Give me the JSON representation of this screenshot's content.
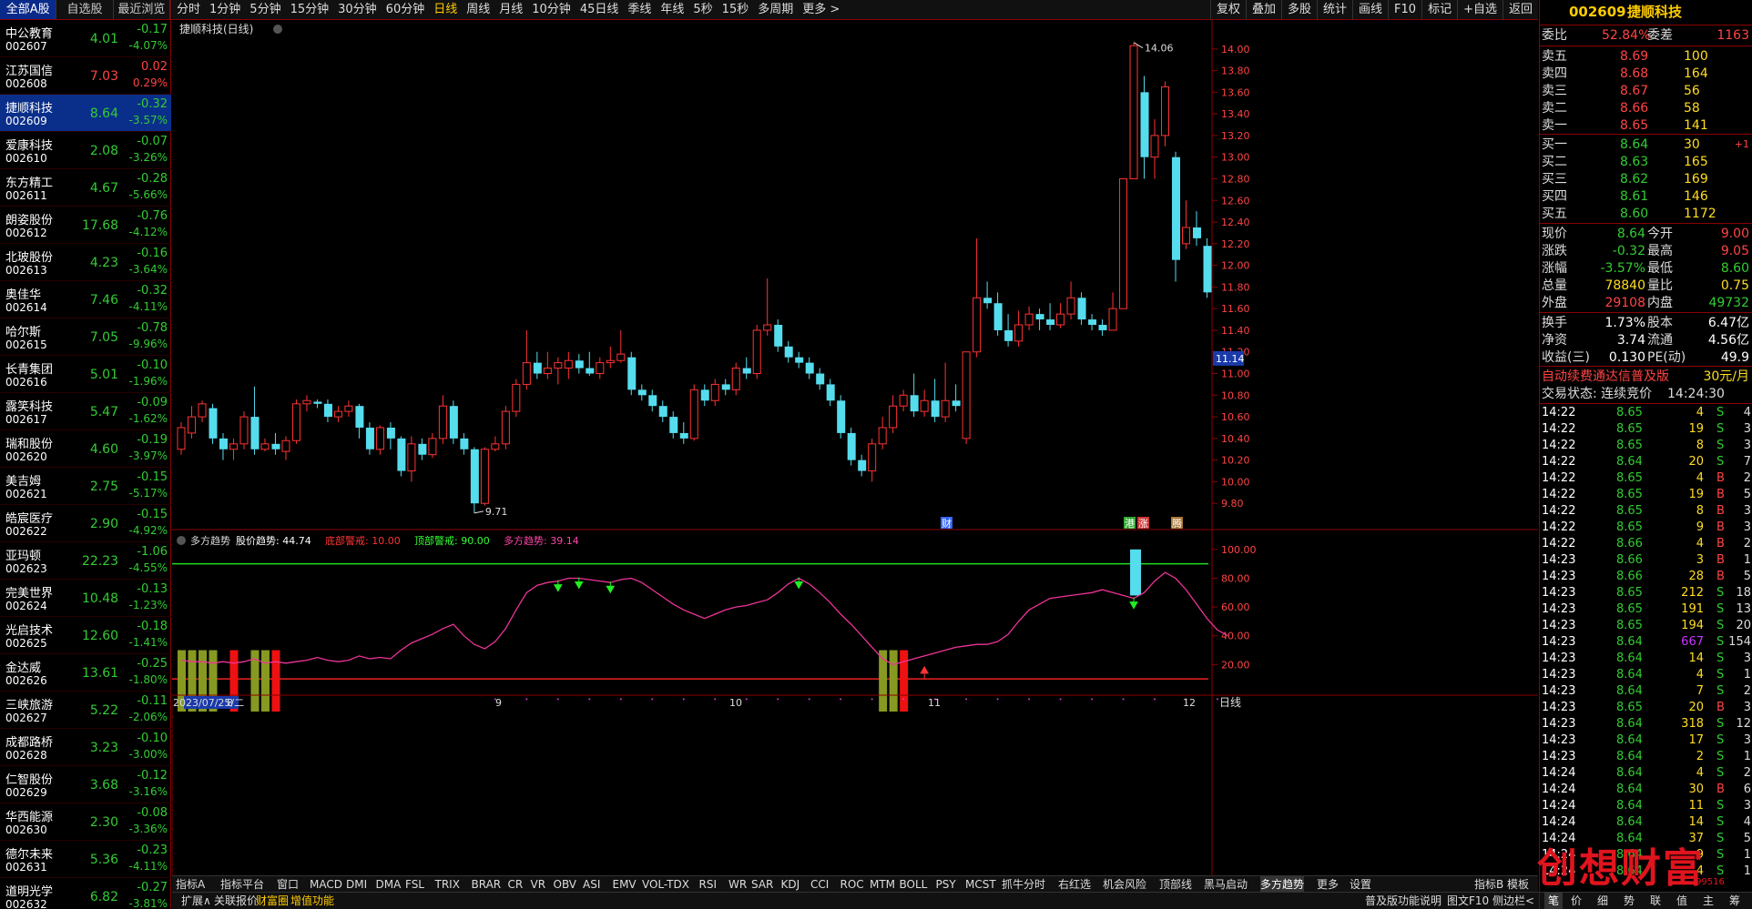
{
  "left_tabs": [
    "全部A股",
    "自选股",
    "最近浏览"
  ],
  "stocks": [
    {
      "name": "中公教育",
      "code": "002607",
      "price": "4.01",
      "change": "-0.17",
      "pct": "-4.07%",
      "dir": "dn"
    },
    {
      "name": "江苏国信",
      "code": "002608",
      "price": "7.03",
      "change": "0.02",
      "pct": "0.29%",
      "dir": "up"
    },
    {
      "name": "捷顺科技",
      "code": "002609",
      "price": "8.64",
      "change": "-0.32",
      "pct": "-3.57%",
      "dir": "dn",
      "selected": true
    },
    {
      "name": "爱康科技",
      "code": "002610",
      "price": "2.08",
      "change": "-0.07",
      "pct": "-3.26%",
      "dir": "dn"
    },
    {
      "name": "东方精工",
      "code": "002611",
      "price": "4.67",
      "change": "-0.28",
      "pct": "-5.66%",
      "dir": "dn"
    },
    {
      "name": "朗姿股份",
      "code": "002612",
      "price": "17.68",
      "change": "-0.76",
      "pct": "-4.12%",
      "dir": "dn"
    },
    {
      "name": "北玻股份",
      "code": "002613",
      "price": "4.23",
      "change": "-0.16",
      "pct": "-3.64%",
      "dir": "dn"
    },
    {
      "name": "奥佳华",
      "code": "002614",
      "price": "7.46",
      "change": "-0.32",
      "pct": "-4.11%",
      "dir": "dn"
    },
    {
      "name": "哈尔斯",
      "code": "002615",
      "price": "7.05",
      "change": "-0.78",
      "pct": "-9.96%",
      "dir": "dn"
    },
    {
      "name": "长青集团",
      "code": "002616",
      "price": "5.01",
      "change": "-0.10",
      "pct": "-1.96%",
      "dir": "dn"
    },
    {
      "name": "露笑科技",
      "code": "002617",
      "price": "5.47",
      "change": "-0.09",
      "pct": "-1.62%",
      "dir": "dn"
    },
    {
      "name": "瑞和股份",
      "code": "002620",
      "price": "4.60",
      "change": "-0.19",
      "pct": "-3.97%",
      "dir": "dn"
    },
    {
      "name": "美吉姆",
      "code": "002621",
      "price": "2.75",
      "change": "-0.15",
      "pct": "-5.17%",
      "dir": "dn"
    },
    {
      "name": "皓宸医疗",
      "code": "002622",
      "price": "2.90",
      "change": "-0.15",
      "pct": "-4.92%",
      "dir": "dn"
    },
    {
      "name": "亚玛顿",
      "code": "002623",
      "price": "22.23",
      "change": "-1.06",
      "pct": "-4.55%",
      "dir": "dn"
    },
    {
      "name": "完美世界",
      "code": "002624",
      "price": "10.48",
      "change": "-0.13",
      "pct": "-1.23%",
      "dir": "dn"
    },
    {
      "name": "光启技术",
      "code": "002625",
      "price": "12.60",
      "change": "-0.18",
      "pct": "-1.41%",
      "dir": "dn"
    },
    {
      "name": "金达威",
      "code": "002626",
      "price": "13.61",
      "change": "-0.25",
      "pct": "-1.80%",
      "dir": "dn"
    },
    {
      "name": "三峡旅游",
      "code": "002627",
      "price": "5.22",
      "change": "-0.11",
      "pct": "-2.06%",
      "dir": "dn"
    },
    {
      "name": "成都路桥",
      "code": "002628",
      "price": "3.23",
      "change": "-0.10",
      "pct": "-3.00%",
      "dir": "dn"
    },
    {
      "name": "仁智股份",
      "code": "002629",
      "price": "3.68",
      "change": "-0.12",
      "pct": "-3.16%",
      "dir": "dn"
    },
    {
      "name": "华西能源",
      "code": "002630",
      "price": "2.30",
      "change": "-0.08",
      "pct": "-3.36%",
      "dir": "dn"
    },
    {
      "name": "德尔未来",
      "code": "002631",
      "price": "5.36",
      "change": "-0.23",
      "pct": "-4.11%",
      "dir": "dn"
    },
    {
      "name": "道明光学",
      "code": "002632",
      "price": "6.82",
      "change": "-0.27",
      "pct": "-3.81%",
      "dir": "dn"
    }
  ],
  "toolbar": {
    "items": [
      "分时",
      "1分钟",
      "5分钟",
      "15分钟",
      "30分钟",
      "60分钟",
      "日线",
      "周线",
      "月线",
      "10分钟",
      "45日线",
      "季线",
      "年线",
      "5秒",
      "15秒",
      "多周期",
      "更多 >"
    ],
    "active": "日线",
    "right": [
      "复权",
      "叠加",
      "多股",
      "统计",
      "画线",
      "F10",
      "标记",
      "+自选",
      "返回"
    ]
  },
  "chart": {
    "title": "捷顺科技(日线)",
    "high_label": "14.06",
    "low_label": "9.71",
    "current_price_tag": "11.14",
    "price_axis": [
      "14.00",
      "13.80",
      "13.60",
      "13.40",
      "13.20",
      "13.00",
      "12.80",
      "12.60",
      "12.40",
      "12.20",
      "12.00",
      "11.80",
      "11.60",
      "11.40",
      "11.20",
      "11.00",
      "10.80",
      "10.60",
      "10.40",
      "10.20",
      "10.00",
      "9.80"
    ],
    "event_marks": [
      "财",
      "港",
      "涨",
      "腾"
    ],
    "indicator_title": "多方趋势",
    "indicator_values": [
      {
        "label": "股价趋势: 44.74",
        "color": "#ffffff"
      },
      {
        "label": "底部警戒: 10.00",
        "color": "#ff3333"
      },
      {
        "label": "顶部警戒: 90.00",
        "color": "#33ff33"
      },
      {
        "label": "多方趋势: 39.14",
        "color": "#ff44aa"
      }
    ],
    "indicator_axis": [
      "100.00",
      "80.00",
      "60.00",
      "40.00",
      "20.00"
    ],
    "date_labels": [
      "2023/07/25/二",
      "8",
      "9",
      "10",
      "11",
      "12"
    ],
    "period_label": "日线"
  },
  "chart_data": {
    "type": "candlestick",
    "ylim": [
      9.6,
      14.2
    ],
    "candles": [
      [
        10.3,
        10.5,
        10.25,
        10.55
      ],
      [
        10.45,
        10.6,
        10.4,
        10.7
      ],
      [
        10.6,
        10.72,
        10.55,
        10.75
      ],
      [
        10.68,
        10.4,
        10.35,
        10.72
      ],
      [
        10.4,
        10.3,
        10.2,
        10.45
      ],
      [
        10.3,
        10.35,
        10.2,
        10.4
      ],
      [
        10.35,
        10.6,
        10.3,
        10.65
      ],
      [
        10.6,
        10.3,
        10.25,
        10.88
      ],
      [
        10.3,
        10.35,
        10.28,
        10.4
      ],
      [
        10.35,
        10.3,
        10.25,
        10.45
      ],
      [
        10.28,
        10.38,
        10.2,
        10.42
      ],
      [
        10.38,
        10.72,
        10.35,
        10.76
      ],
      [
        10.72,
        10.75,
        10.65,
        10.8
      ],
      [
        10.74,
        10.72,
        10.68,
        10.76
      ],
      [
        10.72,
        10.6,
        10.55,
        10.76
      ],
      [
        10.6,
        10.65,
        10.55,
        10.7
      ],
      [
        10.65,
        10.7,
        10.6,
        10.75
      ],
      [
        10.7,
        10.5,
        10.4,
        10.72
      ],
      [
        10.5,
        10.3,
        10.25,
        10.55
      ],
      [
        10.3,
        10.5,
        10.25,
        10.52
      ],
      [
        10.5,
        10.4,
        10.3,
        10.55
      ],
      [
        10.4,
        10.1,
        10.05,
        10.42
      ],
      [
        10.1,
        10.35,
        10.0,
        10.42
      ],
      [
        10.35,
        10.25,
        10.2,
        10.4
      ],
      [
        10.25,
        10.4,
        10.22,
        10.45
      ],
      [
        10.4,
        10.7,
        10.35,
        10.8
      ],
      [
        10.7,
        10.4,
        10.35,
        10.75
      ],
      [
        10.4,
        10.3,
        10.25,
        10.45
      ],
      [
        10.3,
        9.8,
        9.71,
        10.32
      ],
      [
        9.8,
        10.3,
        9.78,
        10.32
      ],
      [
        10.3,
        10.35,
        10.28,
        10.42
      ],
      [
        10.35,
        10.65,
        10.3,
        10.7
      ],
      [
        10.65,
        10.9,
        10.6,
        10.95
      ],
      [
        10.9,
        11.1,
        10.85,
        11.4
      ],
      [
        11.1,
        11.0,
        10.95,
        11.2
      ],
      [
        11.0,
        11.05,
        10.95,
        11.2
      ],
      [
        11.05,
        11.1,
        10.9,
        11.15
      ],
      [
        11.05,
        11.12,
        10.95,
        11.2
      ],
      [
        11.12,
        11.05,
        11.0,
        11.18
      ],
      [
        11.05,
        11.0,
        10.98,
        11.2
      ],
      [
        11.0,
        11.1,
        10.95,
        11.15
      ],
      [
        11.1,
        11.12,
        11.05,
        11.25
      ],
      [
        11.12,
        11.18,
        11.1,
        11.4
      ],
      [
        11.15,
        10.85,
        10.8,
        11.2
      ],
      [
        10.85,
        10.8,
        10.75,
        10.9
      ],
      [
        10.8,
        10.7,
        10.65,
        10.85
      ],
      [
        10.7,
        10.6,
        10.55,
        10.75
      ],
      [
        10.6,
        10.45,
        10.4,
        10.65
      ],
      [
        10.45,
        10.4,
        10.35,
        10.55
      ],
      [
        10.4,
        10.85,
        10.38,
        10.9
      ],
      [
        10.85,
        10.75,
        10.7,
        10.9
      ],
      [
        10.75,
        10.9,
        10.7,
        10.95
      ],
      [
        10.9,
        10.85,
        10.8,
        10.95
      ],
      [
        10.85,
        11.05,
        10.8,
        11.1
      ],
      [
        11.05,
        11.0,
        10.95,
        11.15
      ],
      [
        11.0,
        11.4,
        10.95,
        11.45
      ],
      [
        11.4,
        11.45,
        11.35,
        11.88
      ],
      [
        11.45,
        11.25,
        11.2,
        11.5
      ],
      [
        11.25,
        11.15,
        11.1,
        11.3
      ],
      [
        11.15,
        11.1,
        11.05,
        11.2
      ],
      [
        11.1,
        11.0,
        10.95,
        11.15
      ],
      [
        11.0,
        10.9,
        10.85,
        11.05
      ],
      [
        10.9,
        10.75,
        10.7,
        10.95
      ],
      [
        10.75,
        10.45,
        10.4,
        10.8
      ],
      [
        10.45,
        10.2,
        10.15,
        10.5
      ],
      [
        10.2,
        10.1,
        10.05,
        10.25
      ],
      [
        10.1,
        10.35,
        10.0,
        10.4
      ],
      [
        10.35,
        10.5,
        10.3,
        10.6
      ],
      [
        10.5,
        10.7,
        10.45,
        10.8
      ],
      [
        10.7,
        10.8,
        10.65,
        10.85
      ],
      [
        10.8,
        10.65,
        10.6,
        11.0
      ],
      [
        10.65,
        10.75,
        10.6,
        10.85
      ],
      [
        10.75,
        10.6,
        10.55,
        10.95
      ],
      [
        10.6,
        10.75,
        10.55,
        11.1
      ],
      [
        10.75,
        10.7,
        10.65,
        10.9
      ],
      [
        10.4,
        11.2,
        10.35,
        11.2
      ],
      [
        11.2,
        11.7,
        11.15,
        12.25
      ],
      [
        11.7,
        11.65,
        11.6,
        11.85
      ],
      [
        11.65,
        11.4,
        11.35,
        11.75
      ],
      [
        11.4,
        11.3,
        11.25,
        11.55
      ],
      [
        11.3,
        11.45,
        11.25,
        11.58
      ],
      [
        11.45,
        11.55,
        11.4,
        11.62
      ],
      [
        11.55,
        11.5,
        11.4,
        11.6
      ],
      [
        11.5,
        11.45,
        11.4,
        11.65
      ],
      [
        11.45,
        11.55,
        11.42,
        11.65
      ],
      [
        11.55,
        11.7,
        11.5,
        11.85
      ],
      [
        11.7,
        11.5,
        11.45,
        11.75
      ],
      [
        11.5,
        11.45,
        11.4,
        11.55
      ],
      [
        11.45,
        11.4,
        11.35,
        11.5
      ],
      [
        11.4,
        11.6,
        11.45,
        11.75
      ],
      [
        11.6,
        12.8,
        11.6,
        12.8
      ],
      [
        12.8,
        14.03,
        12.8,
        14.06
      ],
      [
        13.6,
        13.0,
        12.8,
        13.75
      ],
      [
        13.0,
        13.2,
        12.8,
        13.35
      ],
      [
        13.2,
        13.65,
        13.1,
        13.7
      ],
      [
        13.0,
        12.05,
        11.85,
        13.05
      ],
      [
        12.2,
        12.35,
        12.15,
        12.6
      ],
      [
        12.35,
        12.25,
        12.18,
        12.5
      ],
      [
        12.18,
        11.75,
        11.7,
        12.25
      ]
    ],
    "indicator": {
      "trend": [
        23,
        22,
        22,
        21,
        22,
        21,
        22,
        24,
        21,
        22,
        21,
        22,
        23,
        25,
        23,
        22,
        23,
        26,
        24,
        25,
        24,
        30,
        35,
        38,
        41,
        45,
        48,
        40,
        34,
        31,
        36,
        45,
        58,
        70,
        75,
        77,
        78,
        80,
        80,
        79,
        78,
        77,
        79,
        80,
        77,
        72,
        67,
        62,
        58,
        55,
        52,
        55,
        58,
        60,
        61,
        63,
        65,
        70,
        76,
        80,
        76,
        70,
        63,
        55,
        48,
        40,
        32,
        24,
        20,
        22,
        24,
        26,
        28,
        30,
        32,
        33,
        34,
        34,
        36,
        41,
        50,
        58,
        62,
        66,
        67,
        68,
        69,
        70,
        72,
        70,
        68,
        66,
        70,
        78,
        84,
        80,
        72,
        62,
        52,
        44,
        40
      ],
      "top_line": 90,
      "bottom_line": 10,
      "ylim": [
        0,
        110
      ]
    }
  },
  "right_panel": {
    "code": "002609",
    "name": "捷顺科技",
    "weibi": {
      "label": "委比",
      "value": "52.84%",
      "diff_label": "委差",
      "diff": "1163"
    },
    "asks": [
      {
        "label": "卖五",
        "price": "8.69",
        "vol": "100"
      },
      {
        "label": "卖四",
        "price": "8.68",
        "vol": "164"
      },
      {
        "label": "卖三",
        "price": "8.67",
        "vol": "56"
      },
      {
        "label": "卖二",
        "price": "8.66",
        "vol": "58"
      },
      {
        "label": "卖一",
        "price": "8.65",
        "vol": "141"
      }
    ],
    "bids": [
      {
        "label": "买一",
        "price": "8.64",
        "vol": "30",
        "extra": "+1"
      },
      {
        "label": "买二",
        "price": "8.63",
        "vol": "165",
        "extra": ""
      },
      {
        "label": "买三",
        "price": "8.62",
        "vol": "169",
        "extra": ""
      },
      {
        "label": "买四",
        "price": "8.61",
        "vol": "146",
        "extra": ""
      },
      {
        "label": "买五",
        "price": "8.60",
        "vol": "1172",
        "extra": ""
      }
    ],
    "quote": [
      {
        "l1": "现价",
        "v1": "8.64",
        "c1": "dn",
        "l2": "今开",
        "v2": "9.00",
        "c2": "up"
      },
      {
        "l1": "涨跌",
        "v1": "-0.32",
        "c1": "dn",
        "l2": "最高",
        "v2": "9.05",
        "c2": "up"
      },
      {
        "l1": "涨幅",
        "v1": "-3.57%",
        "c1": "dn",
        "l2": "最低",
        "v2": "8.60",
        "c2": "dn"
      },
      {
        "l1": "总量",
        "v1": "78840",
        "c1": "yl",
        "l2": "量比",
        "v2": "0.75",
        "c2": "yl"
      },
      {
        "l1": "外盘",
        "v1": "29108",
        "c1": "up",
        "l2": "内盘",
        "v2": "49732",
        "c2": "dn"
      }
    ],
    "fin": [
      {
        "l1": "换手",
        "v1": "1.73%",
        "l2": "股本",
        "v2": "6.47亿"
      },
      {
        "l1": "净资",
        "v1": "3.74",
        "l2": "流通",
        "v2": "4.56亿"
      },
      {
        "l1": "收益(三)",
        "v1": "0.130",
        "l2": "PE(动)",
        "v2": "49.9"
      }
    ],
    "promo": {
      "text": "自动续费通达信普及版",
      "price": "30元/月"
    },
    "trade_status": {
      "label": "交易状态: 连续竞价",
      "time": "14:24:30"
    },
    "ticks": [
      [
        "14:22",
        "8.65",
        "4",
        "S",
        "4"
      ],
      [
        "14:22",
        "8.65",
        "19",
        "S",
        "3"
      ],
      [
        "14:22",
        "8.65",
        "8",
        "S",
        "3"
      ],
      [
        "14:22",
        "8.64",
        "20",
        "S",
        "7"
      ],
      [
        "14:22",
        "8.65",
        "4",
        "B",
        "2"
      ],
      [
        "14:22",
        "8.65",
        "19",
        "B",
        "5"
      ],
      [
        "14:22",
        "8.65",
        "8",
        "B",
        "3"
      ],
      [
        "14:22",
        "8.65",
        "9",
        "B",
        "3"
      ],
      [
        "14:22",
        "8.66",
        "4",
        "B",
        "2"
      ],
      [
        "14:23",
        "8.66",
        "3",
        "B",
        "1"
      ],
      [
        "14:23",
        "8.66",
        "28",
        "B",
        "5"
      ],
      [
        "14:23",
        "8.65",
        "212",
        "S",
        "18"
      ],
      [
        "14:23",
        "8.65",
        "191",
        "S",
        "13"
      ],
      [
        "14:23",
        "8.65",
        "194",
        "S",
        "20"
      ],
      [
        "14:23",
        "8.64",
        "667",
        "S",
        "154"
      ],
      [
        "14:23",
        "8.64",
        "14",
        "S",
        "3"
      ],
      [
        "14:23",
        "8.64",
        "4",
        "S",
        "1"
      ],
      [
        "14:23",
        "8.64",
        "7",
        "S",
        "2"
      ],
      [
        "14:23",
        "8.65",
        "20",
        "B",
        "3"
      ],
      [
        "14:23",
        "8.64",
        "318",
        "S",
        "12"
      ],
      [
        "14:23",
        "8.64",
        "17",
        "S",
        "3"
      ],
      [
        "14:23",
        "8.64",
        "2",
        "S",
        "1"
      ],
      [
        "14:24",
        "8.64",
        "4",
        "S",
        "2"
      ],
      [
        "14:24",
        "8.64",
        "30",
        "B",
        "6"
      ],
      [
        "14:24",
        "8.64",
        "11",
        "S",
        "3"
      ],
      [
        "14:24",
        "8.64",
        "14",
        "S",
        "4"
      ],
      [
        "14:24",
        "8.64",
        "37",
        "S",
        "5"
      ],
      [
        "14:24",
        "8.64",
        "9",
        "S",
        "1"
      ],
      [
        "14:24",
        "8.64",
        "4",
        "S",
        "1"
      ]
    ]
  },
  "bottom_tabs": [
    "指标A",
    "指标平台",
    "窗口",
    "MACD",
    "DMI",
    "DMA",
    "FSL",
    "TRIX",
    "BRAR",
    "CR",
    "VR",
    "OBV",
    "ASI",
    "EMV",
    "VOL-TDX",
    "RSI",
    "WR",
    "SAR",
    "KDJ",
    "CCI",
    "ROC",
    "MTM",
    "BOLL",
    "PSY",
    "MCST",
    "抓牛分时",
    "右红选",
    "机会风险",
    "顶部线",
    "黑马启动",
    "多方趋势",
    "更多",
    "设置"
  ],
  "bottom_tab_active": "多方趋势",
  "bottom_tab_right": [
    "指标B",
    "模板"
  ],
  "bottom2_left": [
    "扩展∧",
    "关联报价",
    "财富圈",
    "增值功能"
  ],
  "bottom2_right": [
    "普及版功能说明",
    "图文F10",
    "侧边栏<"
  ],
  "bottom2_panel_tabs": [
    "笔",
    "价",
    "细",
    "势",
    "联",
    "值",
    "主",
    "筹"
  ],
  "watermark": "创想财富",
  "watermark_url": "99516"
}
